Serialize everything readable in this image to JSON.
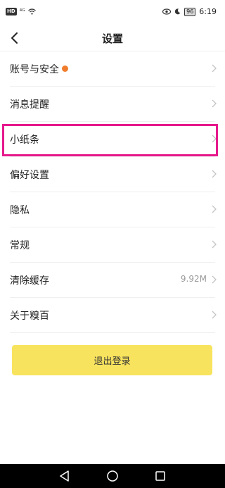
{
  "status_bar": {
    "badge": "HD",
    "signal": "⁴ᴳ",
    "battery": "96",
    "time": "6:19"
  },
  "nav": {
    "title": "设置"
  },
  "settings": {
    "items": [
      {
        "label": "账号与安全",
        "value": "",
        "has_dot": true
      },
      {
        "label": "消息提醒",
        "value": ""
      },
      {
        "label": "小纸条",
        "value": "",
        "highlighted": true
      },
      {
        "label": "偏好设置",
        "value": ""
      },
      {
        "label": "隐私",
        "value": ""
      },
      {
        "label": "常规",
        "value": ""
      },
      {
        "label": "清除缓存",
        "value": "9.92M"
      },
      {
        "label": "关于糗百",
        "value": ""
      }
    ]
  },
  "logout": {
    "label": "退出登录"
  },
  "colors": {
    "accent_button": "#f8e35e",
    "highlight": "#e6198c",
    "notification_dot": "#f07d2e"
  },
  "icons": {
    "back": "chevron-left-icon",
    "row_arrow": "chevron-right-icon",
    "system_back": "triangle-back-icon",
    "system_home": "circle-home-icon",
    "system_recent": "square-recent-icon"
  }
}
